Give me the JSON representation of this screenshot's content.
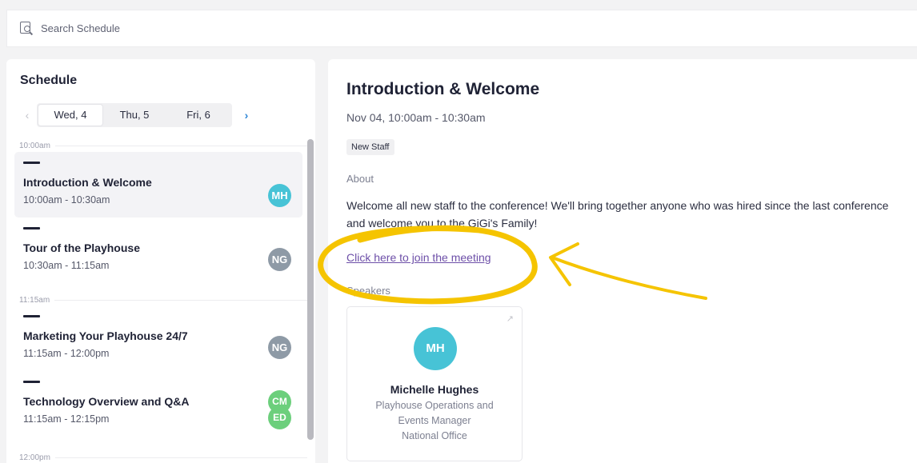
{
  "search": {
    "placeholder": "Search Schedule"
  },
  "schedule": {
    "title": "Schedule",
    "prev_arrow": "‹",
    "next_arrow": "›",
    "days": [
      {
        "label": "Wed, 4",
        "active": true
      },
      {
        "label": "Thu, 5",
        "active": false
      },
      {
        "label": "Fri, 6",
        "active": false
      }
    ],
    "time_labels": [
      "10:00am",
      "11:15am",
      "12:00pm"
    ],
    "sessions": [
      {
        "title": "Introduction & Welcome",
        "time": "10:00am - 10:30am",
        "speakers": [
          {
            "initials": "MH",
            "color": "#47c3d6"
          }
        ]
      },
      {
        "title": "Tour of the Playhouse",
        "time": "10:30am - 11:15am",
        "speakers": [
          {
            "initials": "NG",
            "color": "#8e9aa6"
          }
        ]
      },
      {
        "title": "Marketing Your Playhouse 24/7",
        "time": "11:15am - 12:00pm",
        "speakers": [
          {
            "initials": "NG",
            "color": "#8e9aa6"
          }
        ]
      },
      {
        "title": "Technology Overview and Q&A",
        "time": "11:15am - 12:15pm",
        "speakers": [
          {
            "initials": "CM",
            "color": "#6ccf7c"
          },
          {
            "initials": "ED",
            "color": "#6ccf7c"
          }
        ]
      }
    ]
  },
  "detail": {
    "title": "Introduction & Welcome",
    "date": "Nov 04, 10:00am - 10:30am",
    "tag": "New Staff",
    "about_label": "About",
    "about_text": "Welcome all new staff to the conference! We'll bring together anyone who was hired since the last conference and welcome you to the GiGi's Family!",
    "join_link": "Click here to join the meeting",
    "speakers_label": "Speakers",
    "speakers": [
      {
        "initials": "MH",
        "name": "Michelle Hughes",
        "role_line1": "Playhouse Operations and",
        "role_line2": "Events Manager",
        "role_line3": "National Office"
      }
    ]
  },
  "colors": {
    "accent": "#2e86d6",
    "link": "#6d4fa8",
    "highlight": "#f5c400"
  }
}
